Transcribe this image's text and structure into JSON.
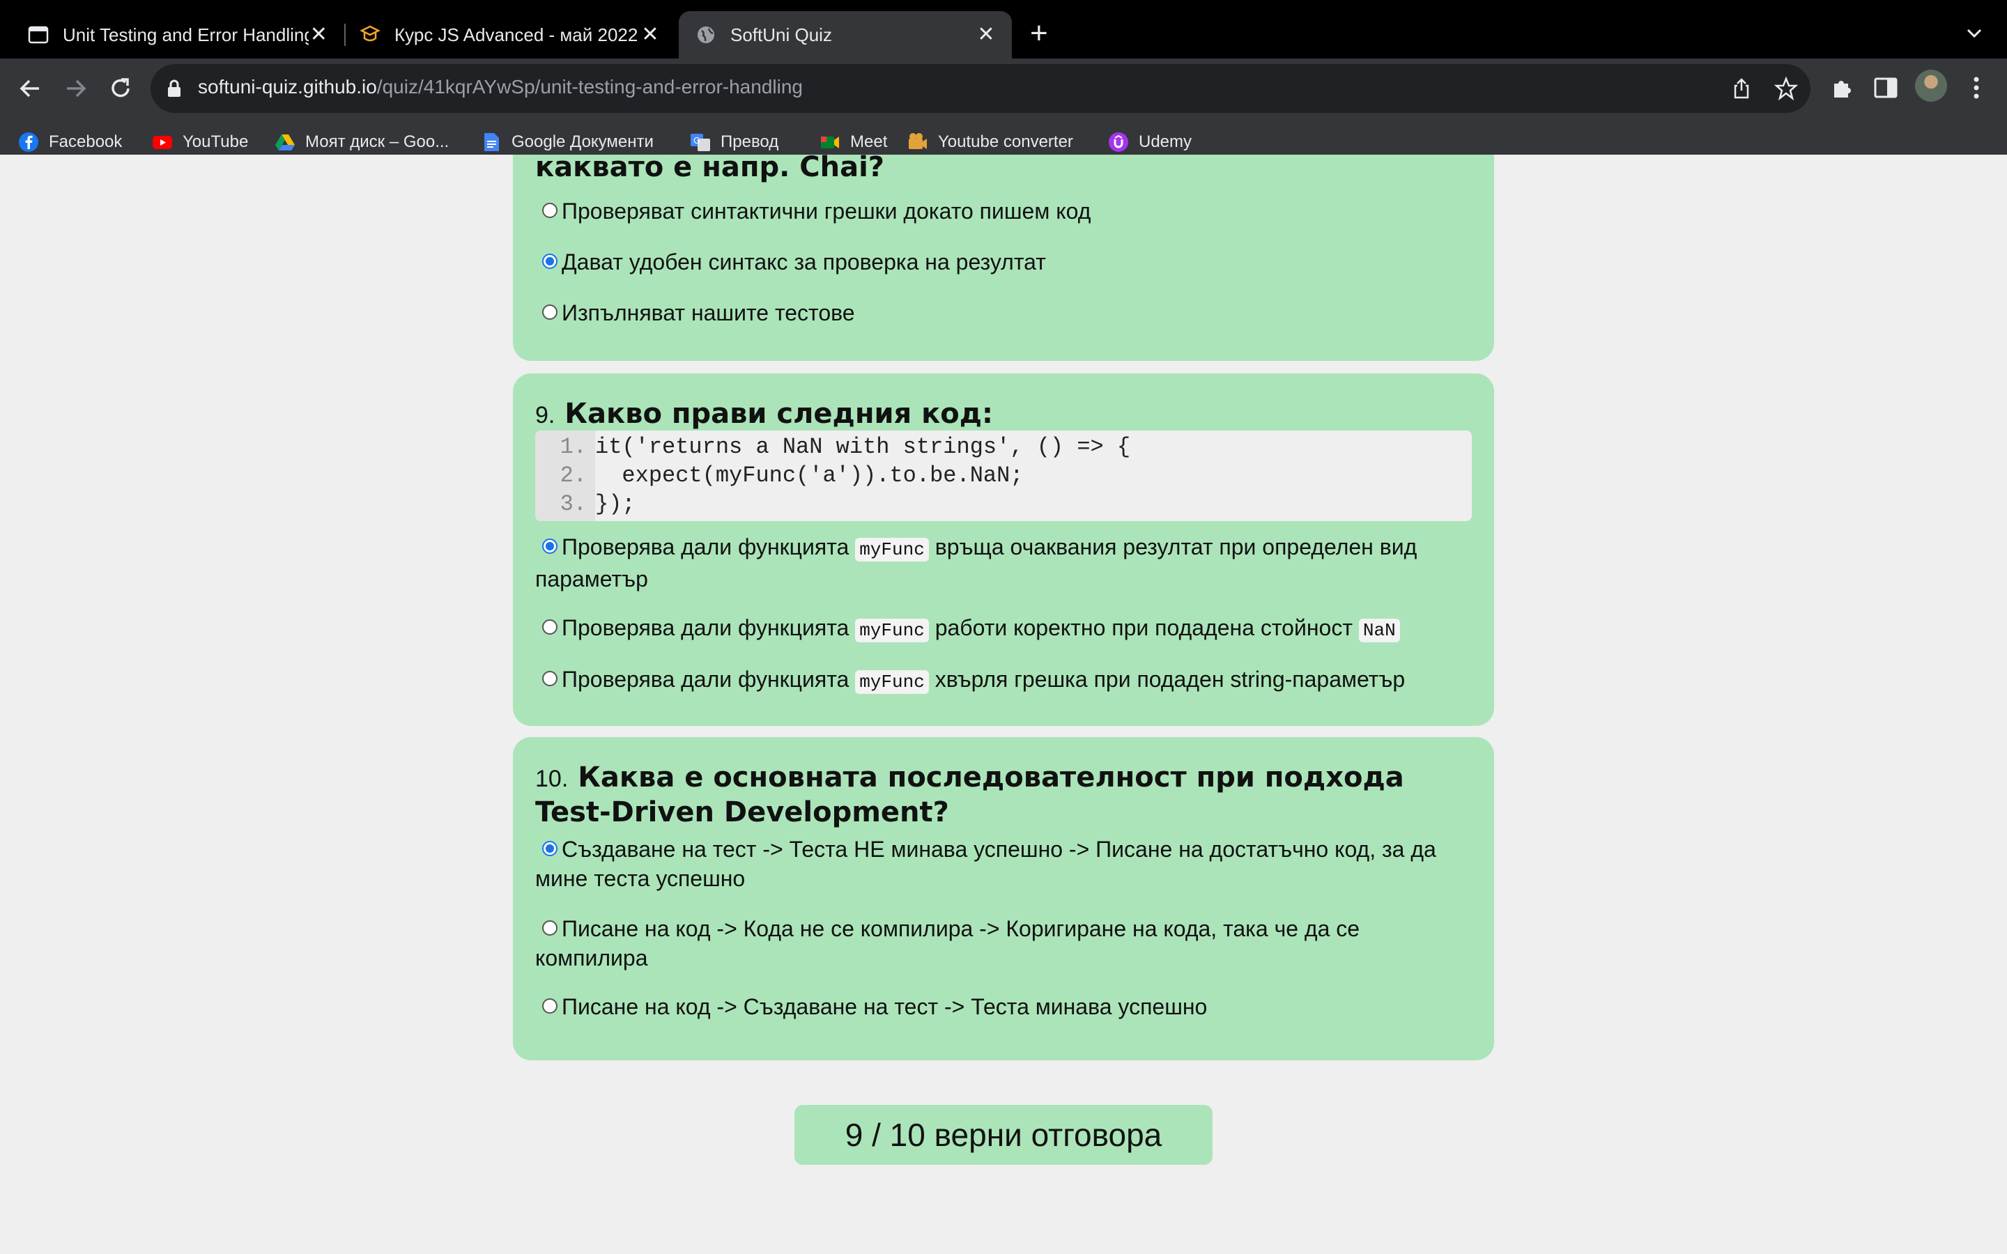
{
  "browser": {
    "tabs": [
      {
        "title": "Unit Testing and Error Handling",
        "icon": "window-icon"
      },
      {
        "title": "Курс JS Advanced - май 2022",
        "icon": "softuni-logo-icon"
      },
      {
        "title": "SoftUni Quiz",
        "icon": "globe-icon"
      }
    ],
    "close_glyph": "✕",
    "new_tab_glyph": "+",
    "url": {
      "host": "softuni-quiz.github.io",
      "path": "/quiz/41kqrAYwSp/unit-testing-and-error-handling"
    },
    "bookmarks": [
      {
        "label": "Facebook",
        "icon": "facebook-icon"
      },
      {
        "label": "YouTube",
        "icon": "youtube-icon"
      },
      {
        "label": "Моят диск – Goo...",
        "icon": "google-drive-icon"
      },
      {
        "label": "Google Документи",
        "icon": "google-docs-icon"
      },
      {
        "label": "Превод",
        "icon": "google-translate-icon"
      },
      {
        "label": "Meet",
        "icon": "google-meet-icon"
      },
      {
        "label": "Youtube converter",
        "icon": "converter-icon"
      },
      {
        "label": "Udemy",
        "icon": "udemy-icon"
      }
    ]
  },
  "quiz": {
    "q8": {
      "question_tail": "каквато е напр. Chai?",
      "options": [
        {
          "text": "Проверяват синтактични грешки докато пишем код",
          "selected": false
        },
        {
          "text": "Дават удобен синтакс за проверка на резултат",
          "selected": true
        },
        {
          "text": "Изпълняват нашите тестове",
          "selected": false
        }
      ]
    },
    "q9": {
      "number": "9.",
      "question": "Какво прави следния код:",
      "code": [
        {
          "ln": "1.",
          "src": "it('returns a NaN with strings', () => {"
        },
        {
          "ln": "2.",
          "src": "  expect(myFunc('a')).to.be.NaN;"
        },
        {
          "ln": "3.",
          "src": "});"
        }
      ],
      "options": [
        {
          "pre": "Проверява дали функцията",
          "code": "myFunc",
          "post": "връща очаквания резултат при определен вид параметър",
          "selected": true
        },
        {
          "pre": "Проверява дали функцията",
          "code": "myFunc",
          "post": "работи коректно при подадена стойност",
          "code2": "NaN",
          "selected": false
        },
        {
          "pre": "Проверява дали функцията",
          "code": "myFunc",
          "post": "хвърля грешка при подаден string-параметър",
          "selected": false
        }
      ]
    },
    "q10": {
      "number": "10.",
      "question": "Каква е основната последователност при подхода Test-Driven Development?",
      "options": [
        {
          "text": "Създаване на тест -> Теста НЕ минава успешно -> Писане на достатъчно код, за да мине теста успешно",
          "selected": true
        },
        {
          "text": "Писане на код -> Кода не се компилира -> Коригиране на кода, така че да се компилира",
          "selected": false
        },
        {
          "text": "Писане на код -> Създаване на тест -> Теста минава успешно",
          "selected": false
        }
      ]
    },
    "score": "9 / 10 верни отговора"
  },
  "colors": {
    "card_bg": "#abe4b9",
    "page_bg": "#efefef",
    "chrome_dark": "#35363a",
    "radio_selected": "#1a73e8"
  }
}
